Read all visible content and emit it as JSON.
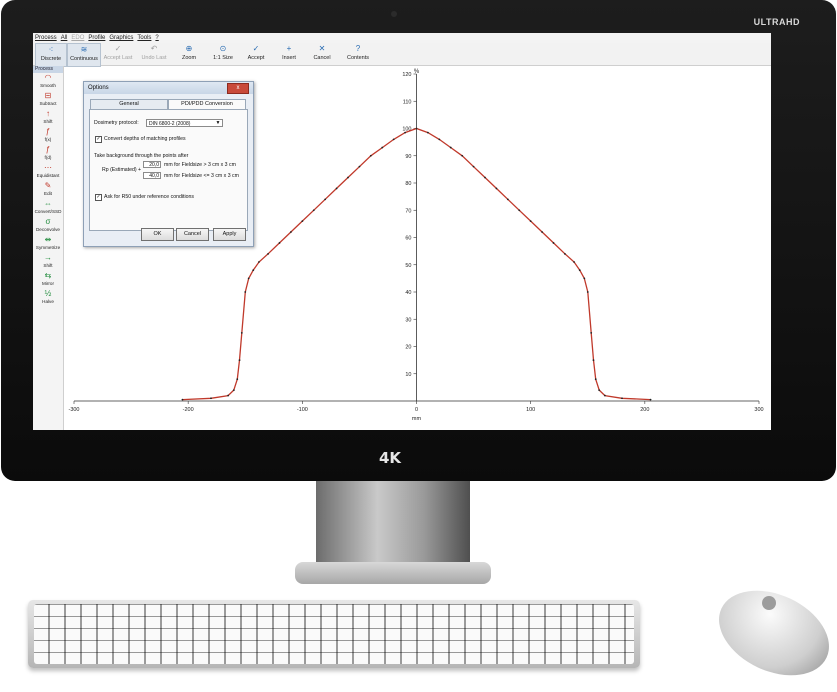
{
  "monitor": {
    "brand_label": "ULTRAHD",
    "logo": "4K"
  },
  "menu": [
    {
      "label": "Process",
      "enabled": true
    },
    {
      "label": "All",
      "enabled": true
    },
    {
      "label": "EDO",
      "enabled": false
    },
    {
      "label": "Profile",
      "enabled": true
    },
    {
      "label": "Graphics",
      "enabled": true
    },
    {
      "label": "Tools",
      "enabled": true
    },
    {
      "label": "?",
      "enabled": true
    }
  ],
  "toolbar": [
    {
      "label": "Discrete",
      "icon": "discrete-icon",
      "enabled": true,
      "active": true
    },
    {
      "label": "Continuous",
      "icon": "continuous-icon",
      "enabled": true,
      "active": true
    },
    {
      "label": "Accept Last",
      "icon": "accept-last-icon",
      "enabled": false
    },
    {
      "label": "Undo Last",
      "icon": "undo-icon",
      "enabled": false
    },
    {
      "label": "Zoom",
      "icon": "zoom-icon",
      "enabled": true
    },
    {
      "label": "1:1 Size",
      "icon": "zoom-reset-icon",
      "enabled": true
    },
    {
      "label": "Accept",
      "icon": "accept-icon",
      "enabled": true
    },
    {
      "label": "Insert",
      "icon": "insert-icon",
      "enabled": true
    },
    {
      "label": "Cancel",
      "icon": "cancel-icon",
      "enabled": true
    },
    {
      "label": "Contents",
      "icon": "help-icon",
      "enabled": true
    }
  ],
  "sidebar": {
    "header": "Process",
    "items": [
      {
        "label": "Smooth",
        "icon": "smooth-icon",
        "color": "#c0392b"
      },
      {
        "label": "Subtract",
        "icon": "subtract-icon",
        "color": "#c0392b"
      },
      {
        "label": "Shift",
        "icon": "shift-up-icon",
        "color": "#c0392b"
      },
      {
        "label": "f(x)",
        "icon": "function-icon",
        "color": "#c0392b"
      },
      {
        "label": "f(d)",
        "icon": "function-d-icon",
        "color": "#c0392b"
      },
      {
        "label": "Equidistant",
        "icon": "equidistant-icon",
        "color": "#c0392b"
      },
      {
        "label": "Edit",
        "icon": "edit-icon",
        "color": "#c0392b"
      },
      {
        "label": "Convert/SSD",
        "icon": "convert-icon",
        "color": "#1e8a3a"
      },
      {
        "label": "Deconvolve",
        "icon": "deconvolve-icon",
        "color": "#1e8a3a"
      },
      {
        "label": "Symmetrize",
        "icon": "symmetrize-icon",
        "color": "#1e8a3a"
      },
      {
        "label": "Shift",
        "icon": "shift-right-icon",
        "color": "#1e8a3a"
      },
      {
        "label": "Mirror",
        "icon": "mirror-icon",
        "color": "#1e8a3a"
      },
      {
        "label": "Halve",
        "icon": "halve-icon",
        "color": "#1e8a3a"
      }
    ]
  },
  "dialog": {
    "title": "Options",
    "close_label": "x",
    "tabs": [
      {
        "label": "General"
      },
      {
        "label": "PDI/PDD Conversion"
      }
    ],
    "protocol_label": "Dosimetry protocol:",
    "protocol_value": "DIN 6800-2 (2008)",
    "convert_checked": true,
    "convert_label": "Convert depths of matching profiles",
    "background_label": "Take background through the points after",
    "rp_label": "Rp (Estimated) +",
    "value1": "20,0",
    "value1_suffix": "mm for Fieldsize > 3 cm x 3 cm",
    "value2": "40,0",
    "value2_suffix": "mm for Fieldsize <= 3 cm x 3 cm",
    "ask_checked": true,
    "ask_label": "Ask for R50 under reference conditions",
    "ok_label": "OK",
    "cancel_label": "Cancel",
    "apply_label": "Apply"
  },
  "chart_data": {
    "type": "line",
    "ylabel": "%",
    "xlabel": "mm",
    "xlim": [
      -300,
      300
    ],
    "ylim": [
      0,
      120
    ],
    "x_ticks": [
      -300,
      -200,
      -100,
      0,
      100,
      200,
      300
    ],
    "y_ticks": [
      10,
      20,
      30,
      40,
      50,
      60,
      70,
      80,
      90,
      100,
      110,
      120
    ],
    "series": [
      {
        "line_color": "#c0392b",
        "marker_color": "#222222",
        "x": [
          -205,
          -180,
          -165,
          -160,
          -157,
          -155,
          -153,
          -150,
          -147,
          -143,
          -138,
          -130,
          -120,
          -110,
          -100,
          -90,
          -80,
          -70,
          -60,
          -50,
          -40,
          -30,
          -20,
          -10,
          0,
          10,
          20,
          30,
          40,
          50,
          60,
          70,
          80,
          90,
          100,
          110,
          120,
          130,
          138,
          143,
          147,
          150,
          153,
          155,
          157,
          160,
          165,
          180,
          205
        ],
        "y": [
          0.5,
          1,
          2,
          4,
          8,
          15,
          25,
          40,
          45,
          48,
          51,
          54,
          58,
          62,
          66,
          70,
          74,
          78,
          82,
          86,
          90,
          93,
          96,
          98.5,
          100,
          98.5,
          96,
          93,
          90,
          86,
          82,
          78,
          74,
          70,
          66,
          62,
          58,
          54,
          51,
          48,
          45,
          40,
          25,
          15,
          8,
          4,
          2,
          1,
          0.5
        ]
      }
    ]
  }
}
